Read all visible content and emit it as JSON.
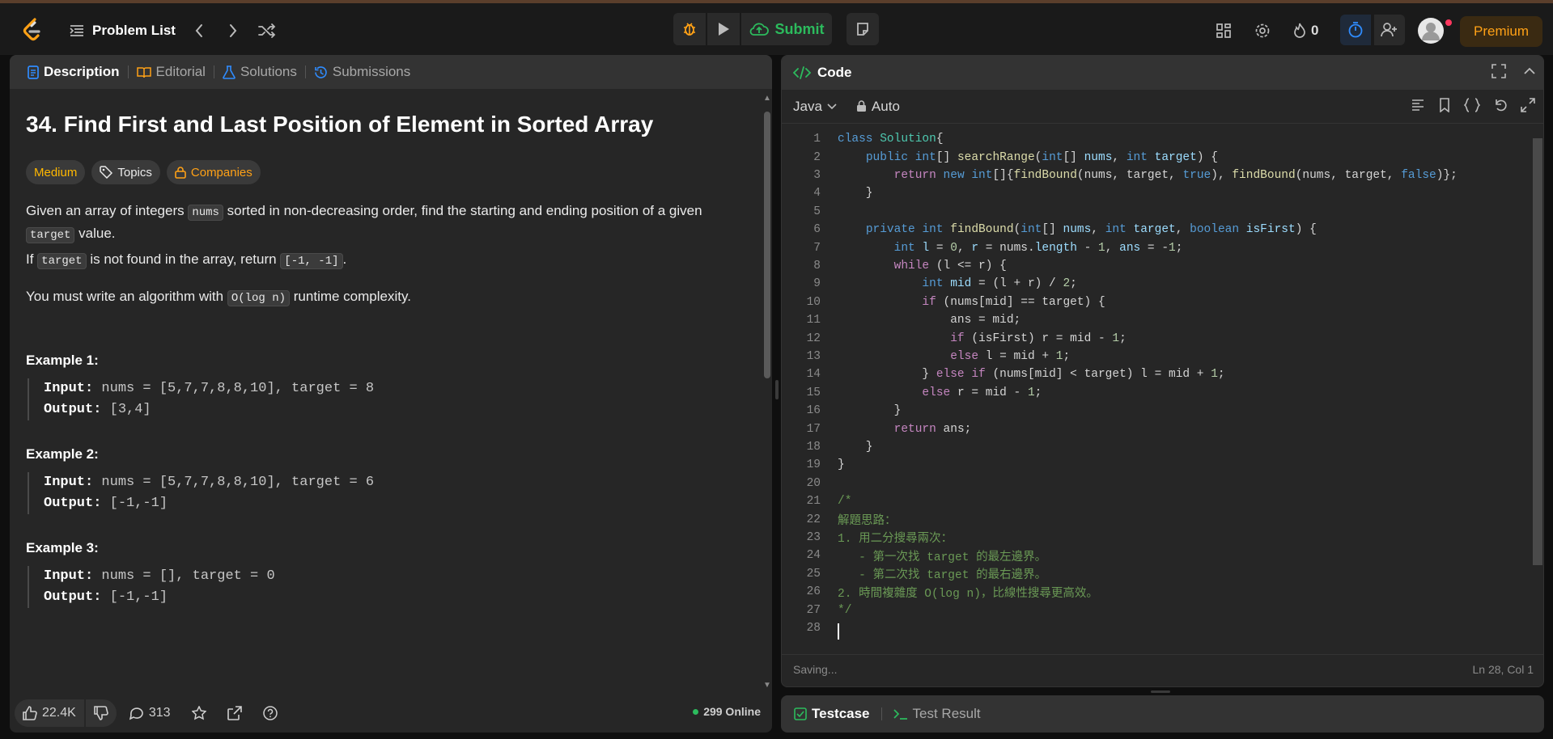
{
  "navbar": {
    "problem_list": "Problem List",
    "submit": "Submit",
    "streak_count": "0",
    "premium": "Premium"
  },
  "tabs": [
    {
      "label": "Description"
    },
    {
      "label": "Editorial"
    },
    {
      "label": "Solutions"
    },
    {
      "label": "Submissions"
    }
  ],
  "problem": {
    "title": "34. Find First and Last Position of Element in Sorted Array",
    "difficulty": "Medium",
    "topics": "Topics",
    "companies": "Companies",
    "p1_a": "Given an array of integers ",
    "p1_code": "nums",
    "p1_b": " sorted in non-decreasing order, find the starting and ending position of a given",
    "p1_code2": "target",
    "p1_c": " value.",
    "p2_a": "If ",
    "p2_code": "target",
    "p2_b": " is not found in the array, return ",
    "p2_code2": "[-1, -1]",
    "p2_c": ".",
    "p3_a": "You must write an algorithm with ",
    "p3_code": "O(log n)",
    "p3_b": " runtime complexity.",
    "examples": [
      {
        "heading": "Example 1:",
        "input_label": "Input:",
        "input": " nums = [5,7,7,8,8,10], target = 8",
        "output_label": "Output:",
        "output": " [3,4]"
      },
      {
        "heading": "Example 2:",
        "input_label": "Input:",
        "input": " nums = [5,7,7,8,8,10], target = 6",
        "output_label": "Output:",
        "output": " [-1,-1]"
      },
      {
        "heading": "Example 3:",
        "input_label": "Input:",
        "input": " nums = [], target = 0",
        "output_label": "Output:",
        "output": " [-1,-1]"
      }
    ]
  },
  "bottom": {
    "likes": "22.4K",
    "comments": "313",
    "online": "299 Online"
  },
  "code_panel": {
    "title": "Code",
    "language": "Java",
    "mode": "Auto",
    "status_left": "Saving...",
    "status_right": "Ln 28, Col 1"
  },
  "code_lines": [
    [
      [
        "kb",
        "class "
      ],
      [
        "ty",
        "Solution"
      ],
      [
        "",
        "{"
      ]
    ],
    [
      [
        "",
        "    "
      ],
      [
        "kb",
        "public "
      ],
      [
        "kb",
        "int"
      ],
      [
        "",
        "[] "
      ],
      [
        "fn",
        "searchRange"
      ],
      [
        "",
        "("
      ],
      [
        "kb",
        "int"
      ],
      [
        "",
        "[] "
      ],
      [
        "vr",
        "nums"
      ],
      [
        "",
        ", "
      ],
      [
        "kb",
        "int "
      ],
      [
        "vr",
        "target"
      ],
      [
        "",
        ") {"
      ]
    ],
    [
      [
        "",
        "        "
      ],
      [
        "kw",
        "return "
      ],
      [
        "kb",
        "new "
      ],
      [
        "kb",
        "int"
      ],
      [
        "",
        "[]{"
      ],
      [
        "fn",
        "findBound"
      ],
      [
        "",
        "(nums, target, "
      ],
      [
        "kb",
        "true"
      ],
      [
        "",
        "), "
      ],
      [
        "fn",
        "findBound"
      ],
      [
        "",
        "(nums, target, "
      ],
      [
        "kb",
        "false"
      ],
      [
        "",
        ")};"
      ]
    ],
    [
      [
        "",
        "    }"
      ]
    ],
    [
      [
        "",
        ""
      ]
    ],
    [
      [
        "",
        "    "
      ],
      [
        "kb",
        "private "
      ],
      [
        "kb",
        "int "
      ],
      [
        "fn",
        "findBound"
      ],
      [
        "",
        "("
      ],
      [
        "kb",
        "int"
      ],
      [
        "",
        "[] "
      ],
      [
        "vr",
        "nums"
      ],
      [
        "",
        ", "
      ],
      [
        "kb",
        "int "
      ],
      [
        "vr",
        "target"
      ],
      [
        "",
        ", "
      ],
      [
        "kb",
        "boolean "
      ],
      [
        "vr",
        "isFirst"
      ],
      [
        "",
        ") {"
      ]
    ],
    [
      [
        "",
        "        "
      ],
      [
        "kb",
        "int "
      ],
      [
        "vr",
        "l"
      ],
      [
        "",
        " = "
      ],
      [
        "nm",
        "0"
      ],
      [
        "",
        ", "
      ],
      [
        "vr",
        "r"
      ],
      [
        "",
        " = nums."
      ],
      [
        "vr",
        "length"
      ],
      [
        "",
        " - "
      ],
      [
        "nm",
        "1"
      ],
      [
        "",
        ", "
      ],
      [
        "vr",
        "ans"
      ],
      [
        "",
        " = -"
      ],
      [
        "nm",
        "1"
      ],
      [
        "",
        ";"
      ]
    ],
    [
      [
        "",
        "        "
      ],
      [
        "kw",
        "while "
      ],
      [
        "",
        "(l <= r) {"
      ]
    ],
    [
      [
        "",
        "            "
      ],
      [
        "kb",
        "int "
      ],
      [
        "vr",
        "mid"
      ],
      [
        "",
        " = (l + r) / "
      ],
      [
        "nm",
        "2"
      ],
      [
        "",
        ";"
      ]
    ],
    [
      [
        "",
        "            "
      ],
      [
        "kw",
        "if "
      ],
      [
        "",
        "(nums[mid] == target) {"
      ]
    ],
    [
      [
        "",
        "                ans = mid;"
      ]
    ],
    [
      [
        "",
        "                "
      ],
      [
        "kw",
        "if "
      ],
      [
        "",
        "(isFirst) r = mid - "
      ],
      [
        "nm",
        "1"
      ],
      [
        "",
        ";"
      ]
    ],
    [
      [
        "",
        "                "
      ],
      [
        "kw",
        "else "
      ],
      [
        "",
        "l = mid + "
      ],
      [
        "nm",
        "1"
      ],
      [
        "",
        ";"
      ]
    ],
    [
      [
        "",
        "            } "
      ],
      [
        "kw",
        "else if "
      ],
      [
        "",
        "(nums[mid] < target) l = mid + "
      ],
      [
        "nm",
        "1"
      ],
      [
        "",
        ";"
      ]
    ],
    [
      [
        "",
        "            "
      ],
      [
        "kw",
        "else "
      ],
      [
        "",
        "r = mid - "
      ],
      [
        "nm",
        "1"
      ],
      [
        "",
        ";"
      ]
    ],
    [
      [
        "",
        "        }"
      ]
    ],
    [
      [
        "",
        "        "
      ],
      [
        "kw",
        "return "
      ],
      [
        "",
        "ans;"
      ]
    ],
    [
      [
        "",
        "    }"
      ]
    ],
    [
      [
        "",
        "}"
      ]
    ],
    [
      [
        "",
        ""
      ]
    ],
    [
      [
        "cm",
        "/*"
      ]
    ],
    [
      [
        "cm",
        "解題思路："
      ]
    ],
    [
      [
        "cm",
        "1. 用二分搜尋兩次："
      ]
    ],
    [
      [
        "cm",
        "   - 第一次找 target 的最左邊界。"
      ]
    ],
    [
      [
        "cm",
        "   - 第二次找 target 的最右邊界。"
      ]
    ],
    [
      [
        "cm",
        "2. 時間複雜度 O(log n)，比線性搜尋更高效。"
      ]
    ],
    [
      [
        "cm",
        "*/"
      ]
    ],
    [
      [
        "",
        ""
      ]
    ]
  ],
  "test_panel": {
    "testcase": "Testcase",
    "test_result": "Test Result"
  },
  "colors": {
    "accent_orange": "#ffa116",
    "submit_green": "#2cbb5d",
    "panel_bg": "#262626",
    "page_bg": "#0f0f0f"
  },
  "icons": [
    "logo-icon",
    "list-icon",
    "chevron-left-icon",
    "chevron-right-icon",
    "shuffle-icon",
    "debug-icon",
    "play-icon",
    "cloud-upload-icon",
    "note-icon",
    "layout-icon",
    "gear-icon",
    "fire-icon",
    "timer-icon",
    "add-user-icon",
    "doc-icon",
    "book-icon",
    "flask-icon",
    "history-icon",
    "tag-icon",
    "lock-icon",
    "code-icon",
    "expand-icon",
    "collapse-icon",
    "format-icon",
    "bookmark-icon",
    "braces-icon",
    "undo-icon",
    "fullscreen-icon",
    "thumbs-up-icon",
    "thumbs-down-icon",
    "comment-icon",
    "star-icon",
    "share-icon",
    "help-icon",
    "checkbox-icon",
    "terminal-icon"
  ]
}
